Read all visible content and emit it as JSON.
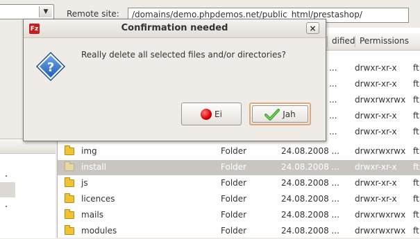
{
  "remote": {
    "label": "Remote site:",
    "path": "/domains/demo.phpdemos.net/public_html/prestashop/"
  },
  "columns": {
    "modified": "dified",
    "permissions": "Permissions"
  },
  "hidden_rows": [
    {
      "date": "08 ...",
      "perms": "drwxr-xr-x",
      "extra": "ft"
    },
    {
      "date": "08 ...",
      "perms": "drwxr-xr-x",
      "extra": "ft"
    },
    {
      "date": "08 ...",
      "perms": "drwxrwxrwx",
      "extra": "ft"
    },
    {
      "date": "08 ...",
      "perms": "drwxr-xr-x",
      "extra": "ft"
    },
    {
      "date": "08 ...",
      "perms": "drwxr-xr-x",
      "extra": "ft"
    }
  ],
  "files": [
    {
      "name": "img",
      "type": "Folder",
      "date": "24.08.2008 ...",
      "perms": "drwxrwxrwx",
      "extra": "ft"
    },
    {
      "name": "install",
      "type": "Folder",
      "date": "24.08.2008 ...",
      "perms": "drwxr-xr-x",
      "extra": "ft"
    },
    {
      "name": "js",
      "type": "Folder",
      "date": "24.08.2008 ...",
      "perms": "drwxr-xr-x",
      "extra": "ft"
    },
    {
      "name": "licences",
      "type": "Folder",
      "date": "24.08.2008 ...",
      "perms": "drwxr-xr-x",
      "extra": "ft"
    },
    {
      "name": "mails",
      "type": "Folder",
      "date": "24.08.2008 ...",
      "perms": "drwxrwxrwx",
      "extra": "ft"
    },
    {
      "name": "modules",
      "type": "Folder",
      "date": "24.08.2008 ...",
      "perms": "drwxrwxrwx",
      "extra": "ft"
    }
  ],
  "dialog": {
    "title": "Confirmation needed",
    "close_glyph": "×",
    "app_icon": "Fz",
    "message": "Really delete all selected files and/or directories?",
    "no_label": "Ei",
    "yes_label": "Jah",
    "icons": {
      "question": "question-diamond-icon",
      "no": "red-circle-icon",
      "yes": "green-check-icon"
    }
  },
  "colors": {
    "accent_blue": "#2e6fc7",
    "selection": "#c9c5c0",
    "folder": "#f1c232"
  }
}
